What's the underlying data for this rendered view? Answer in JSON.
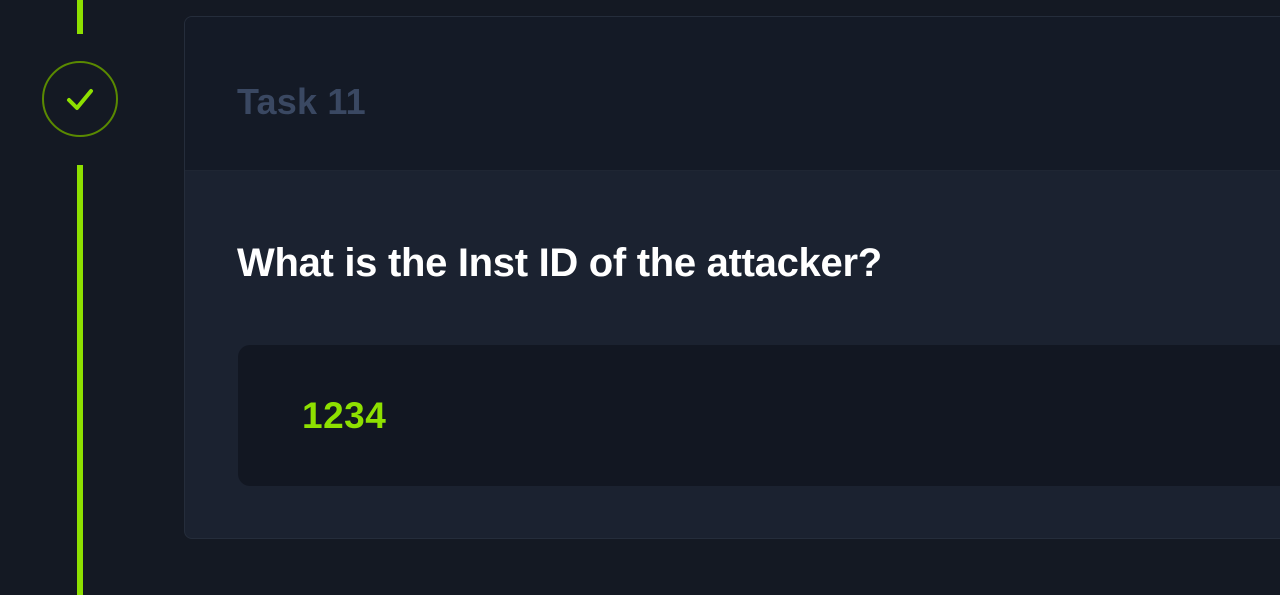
{
  "task": {
    "title": "Task 11",
    "status": "completed",
    "status_icon": "check-icon",
    "question": "What is the Inst ID of the attacker?",
    "answer": "1234"
  },
  "colors": {
    "background": "#141923",
    "accent": "#8ee000",
    "card": "#1b2230",
    "header": "#141a26",
    "title_muted": "#3a4862",
    "answer_box": "#121722"
  }
}
